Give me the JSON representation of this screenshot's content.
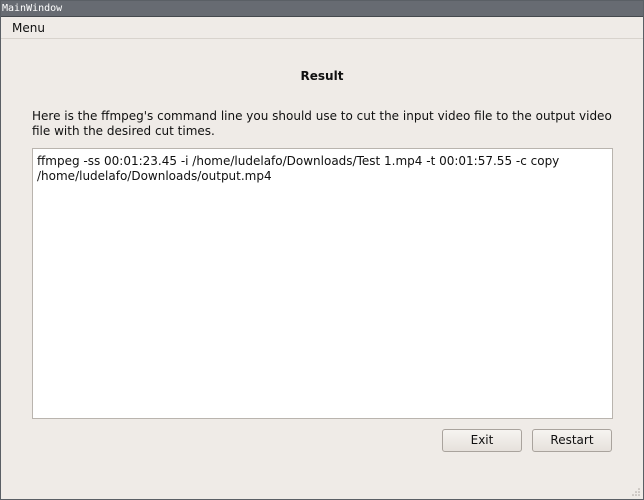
{
  "window": {
    "title": "MainWindow"
  },
  "menubar": {
    "menu_label": "Menu"
  },
  "result": {
    "heading": "Result",
    "description": "Here is the ffmpeg's command line you should use to cut the input video file to the output video file with the desired cut times.",
    "command": "ffmpeg -ss 00:01:23.45 -i /home/ludelafo/Downloads/Test 1.mp4 -t 00:01:57.55 -c copy /home/ludelafo/Downloads/output.mp4"
  },
  "buttons": {
    "exit_label": "Exit",
    "restart_label": "Restart"
  },
  "icons": {
    "resize_grip": "size-grip-icon"
  }
}
